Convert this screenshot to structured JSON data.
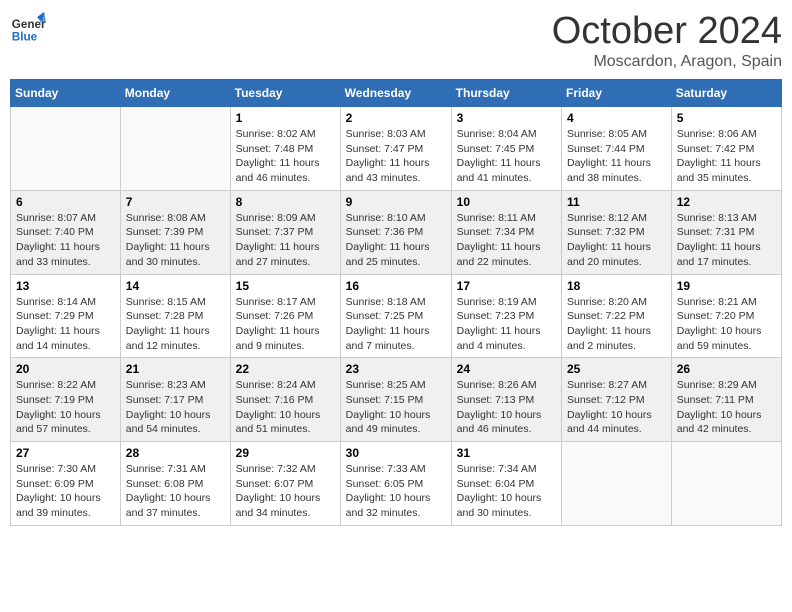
{
  "header": {
    "logo_general": "General",
    "logo_blue": "Blue",
    "month_title": "October 2024",
    "location": "Moscardon, Aragon, Spain"
  },
  "calendar": {
    "days_of_week": [
      "Sunday",
      "Monday",
      "Tuesday",
      "Wednesday",
      "Thursday",
      "Friday",
      "Saturday"
    ],
    "weeks": [
      [
        {
          "day": "",
          "info": ""
        },
        {
          "day": "",
          "info": ""
        },
        {
          "day": "1",
          "info": "Sunrise: 8:02 AM\nSunset: 7:48 PM\nDaylight: 11 hours and 46 minutes."
        },
        {
          "day": "2",
          "info": "Sunrise: 8:03 AM\nSunset: 7:47 PM\nDaylight: 11 hours and 43 minutes."
        },
        {
          "day": "3",
          "info": "Sunrise: 8:04 AM\nSunset: 7:45 PM\nDaylight: 11 hours and 41 minutes."
        },
        {
          "day": "4",
          "info": "Sunrise: 8:05 AM\nSunset: 7:44 PM\nDaylight: 11 hours and 38 minutes."
        },
        {
          "day": "5",
          "info": "Sunrise: 8:06 AM\nSunset: 7:42 PM\nDaylight: 11 hours and 35 minutes."
        }
      ],
      [
        {
          "day": "6",
          "info": "Sunrise: 8:07 AM\nSunset: 7:40 PM\nDaylight: 11 hours and 33 minutes."
        },
        {
          "day": "7",
          "info": "Sunrise: 8:08 AM\nSunset: 7:39 PM\nDaylight: 11 hours and 30 minutes."
        },
        {
          "day": "8",
          "info": "Sunrise: 8:09 AM\nSunset: 7:37 PM\nDaylight: 11 hours and 27 minutes."
        },
        {
          "day": "9",
          "info": "Sunrise: 8:10 AM\nSunset: 7:36 PM\nDaylight: 11 hours and 25 minutes."
        },
        {
          "day": "10",
          "info": "Sunrise: 8:11 AM\nSunset: 7:34 PM\nDaylight: 11 hours and 22 minutes."
        },
        {
          "day": "11",
          "info": "Sunrise: 8:12 AM\nSunset: 7:32 PM\nDaylight: 11 hours and 20 minutes."
        },
        {
          "day": "12",
          "info": "Sunrise: 8:13 AM\nSunset: 7:31 PM\nDaylight: 11 hours and 17 minutes."
        }
      ],
      [
        {
          "day": "13",
          "info": "Sunrise: 8:14 AM\nSunset: 7:29 PM\nDaylight: 11 hours and 14 minutes."
        },
        {
          "day": "14",
          "info": "Sunrise: 8:15 AM\nSunset: 7:28 PM\nDaylight: 11 hours and 12 minutes."
        },
        {
          "day": "15",
          "info": "Sunrise: 8:17 AM\nSunset: 7:26 PM\nDaylight: 11 hours and 9 minutes."
        },
        {
          "day": "16",
          "info": "Sunrise: 8:18 AM\nSunset: 7:25 PM\nDaylight: 11 hours and 7 minutes."
        },
        {
          "day": "17",
          "info": "Sunrise: 8:19 AM\nSunset: 7:23 PM\nDaylight: 11 hours and 4 minutes."
        },
        {
          "day": "18",
          "info": "Sunrise: 8:20 AM\nSunset: 7:22 PM\nDaylight: 11 hours and 2 minutes."
        },
        {
          "day": "19",
          "info": "Sunrise: 8:21 AM\nSunset: 7:20 PM\nDaylight: 10 hours and 59 minutes."
        }
      ],
      [
        {
          "day": "20",
          "info": "Sunrise: 8:22 AM\nSunset: 7:19 PM\nDaylight: 10 hours and 57 minutes."
        },
        {
          "day": "21",
          "info": "Sunrise: 8:23 AM\nSunset: 7:17 PM\nDaylight: 10 hours and 54 minutes."
        },
        {
          "day": "22",
          "info": "Sunrise: 8:24 AM\nSunset: 7:16 PM\nDaylight: 10 hours and 51 minutes."
        },
        {
          "day": "23",
          "info": "Sunrise: 8:25 AM\nSunset: 7:15 PM\nDaylight: 10 hours and 49 minutes."
        },
        {
          "day": "24",
          "info": "Sunrise: 8:26 AM\nSunset: 7:13 PM\nDaylight: 10 hours and 46 minutes."
        },
        {
          "day": "25",
          "info": "Sunrise: 8:27 AM\nSunset: 7:12 PM\nDaylight: 10 hours and 44 minutes."
        },
        {
          "day": "26",
          "info": "Sunrise: 8:29 AM\nSunset: 7:11 PM\nDaylight: 10 hours and 42 minutes."
        }
      ],
      [
        {
          "day": "27",
          "info": "Sunrise: 7:30 AM\nSunset: 6:09 PM\nDaylight: 10 hours and 39 minutes."
        },
        {
          "day": "28",
          "info": "Sunrise: 7:31 AM\nSunset: 6:08 PM\nDaylight: 10 hours and 37 minutes."
        },
        {
          "day": "29",
          "info": "Sunrise: 7:32 AM\nSunset: 6:07 PM\nDaylight: 10 hours and 34 minutes."
        },
        {
          "day": "30",
          "info": "Sunrise: 7:33 AM\nSunset: 6:05 PM\nDaylight: 10 hours and 32 minutes."
        },
        {
          "day": "31",
          "info": "Sunrise: 7:34 AM\nSunset: 6:04 PM\nDaylight: 10 hours and 30 minutes."
        },
        {
          "day": "",
          "info": ""
        },
        {
          "day": "",
          "info": ""
        }
      ]
    ]
  }
}
